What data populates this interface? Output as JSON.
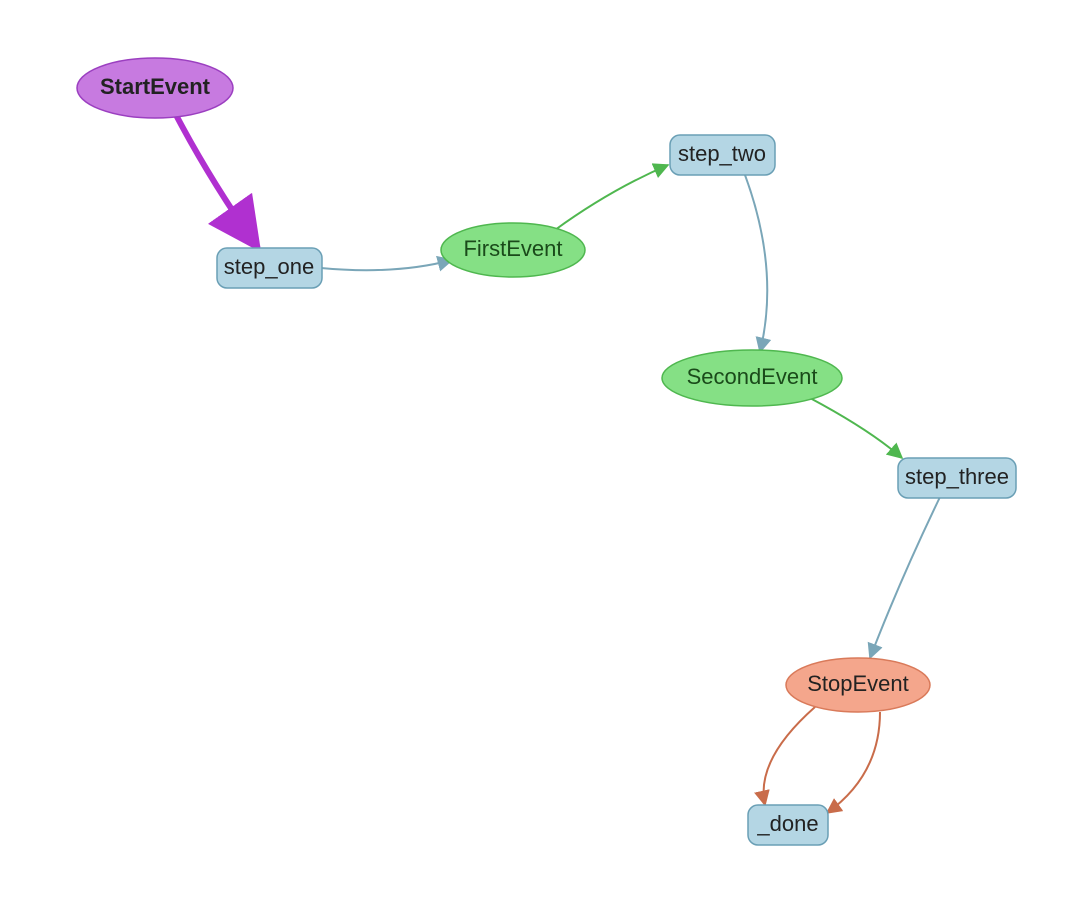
{
  "nodes": {
    "start_event": {
      "label": "StartEvent"
    },
    "step_one": {
      "label": "step_one"
    },
    "first_event": {
      "label": "FirstEvent"
    },
    "step_two": {
      "label": "step_two"
    },
    "second_event": {
      "label": "SecondEvent"
    },
    "step_three": {
      "label": "step_three"
    },
    "stop_event": {
      "label": "StopEvent"
    },
    "done": {
      "label": "_done"
    }
  },
  "colors": {
    "start": "#c77ae0",
    "event": "#85e085",
    "stop": "#f4a68c",
    "step": "#b4d6e4",
    "edge_start": "#b030d0",
    "edge_step": "#7aa6b8",
    "edge_event": "#4fb74f",
    "edge_stop": "#c96c4a"
  }
}
